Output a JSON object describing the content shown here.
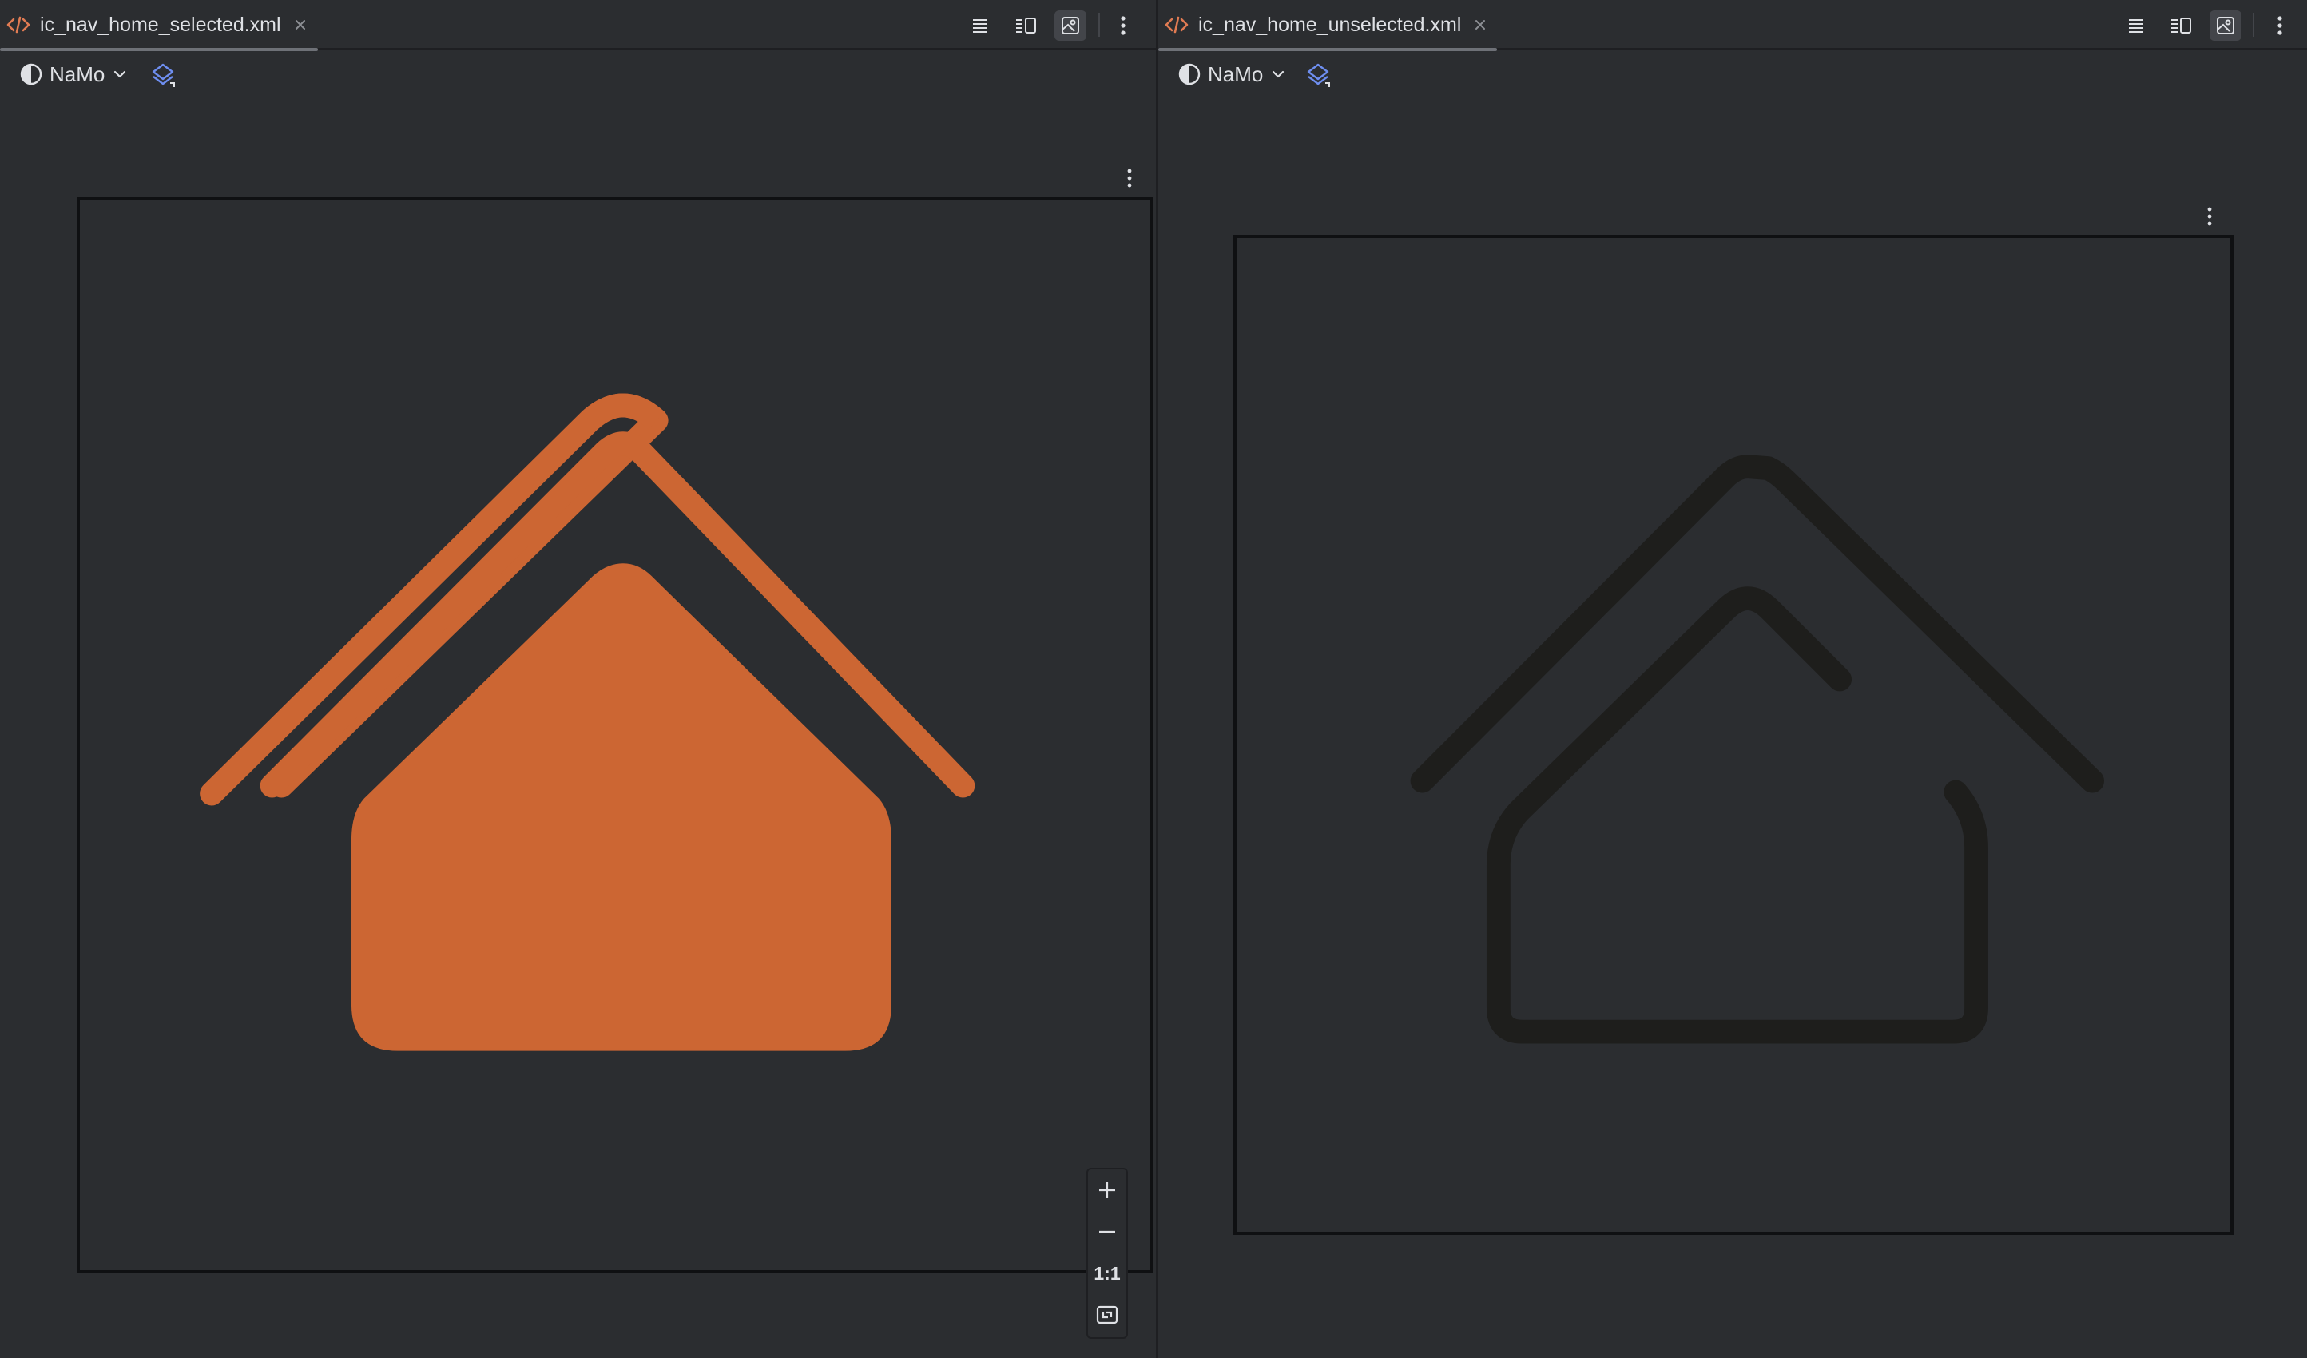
{
  "colors": {
    "accent": "#cc6633",
    "unselected_stroke": "#1e1e1c",
    "background": "#2b2d30",
    "text": "#dfe1e5",
    "xml_icon": "#e07b53",
    "layers_icon": "#6e8ef0"
  },
  "left_pane": {
    "tab": {
      "label": "ic_nav_home_selected.xml",
      "icon": "xml-file-icon",
      "close_icon": "close-icon"
    },
    "toolbar": [
      "code-view-icon",
      "split-view-icon",
      "design-view-icon",
      "more-vertical-icon"
    ],
    "active_view": "design-view-icon",
    "theme": {
      "label": "NaMo"
    },
    "preview": {
      "icon": "home-filled-icon",
      "fill_color": "#cc6633"
    },
    "zoom": {
      "zoom_in": "+",
      "zoom_out": "—",
      "actual_size": "1:1",
      "fit": "fit-screen-icon"
    }
  },
  "right_pane": {
    "tab": {
      "label": "ic_nav_home_unselected.xml",
      "icon": "xml-file-icon",
      "close_icon": "close-icon"
    },
    "toolbar": [
      "code-view-icon",
      "split-view-icon",
      "design-view-icon",
      "more-vertical-icon"
    ],
    "active_view": "design-view-icon",
    "theme": {
      "label": "NaMo"
    },
    "preview": {
      "icon": "home-outline-icon",
      "stroke_color": "#1e1e1c"
    }
  }
}
